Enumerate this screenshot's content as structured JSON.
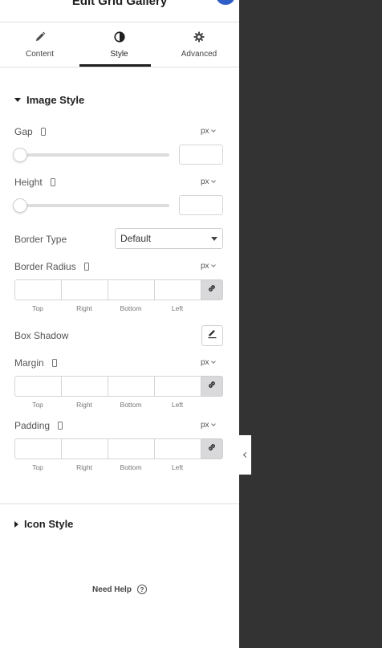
{
  "header": {
    "title": "Edit Grid Gallery"
  },
  "tabs": [
    {
      "label": "Content",
      "icon": "pencil-icon"
    },
    {
      "label": "Style",
      "icon": "half-circle-icon",
      "active": true
    },
    {
      "label": "Advanced",
      "icon": "gear-icon"
    }
  ],
  "image_style": {
    "title": "Image Style",
    "gap": {
      "label": "Gap",
      "unit": "px",
      "value": "",
      "slider_fraction": 0
    },
    "height": {
      "label": "Height",
      "unit": "px",
      "value": "",
      "slider_fraction": 0
    },
    "border_type": {
      "label": "Border Type",
      "value": "Default"
    },
    "border_radius": {
      "label": "Border Radius",
      "unit": "px"
    },
    "box_shadow": {
      "label": "Box Shadow"
    },
    "margin": {
      "label": "Margin",
      "unit": "px"
    },
    "padding": {
      "label": "Padding",
      "unit": "px"
    },
    "dimension_labels": {
      "top": "Top",
      "right": "Right",
      "bottom": "Bottom",
      "left": "Left"
    }
  },
  "icon_style": {
    "title": "Icon Style"
  },
  "help": {
    "label": "Need Help",
    "icon": "question-icon"
  },
  "colors": {
    "background": "#333333",
    "panel": "#ffffff",
    "accent": "#2f5fc6"
  }
}
